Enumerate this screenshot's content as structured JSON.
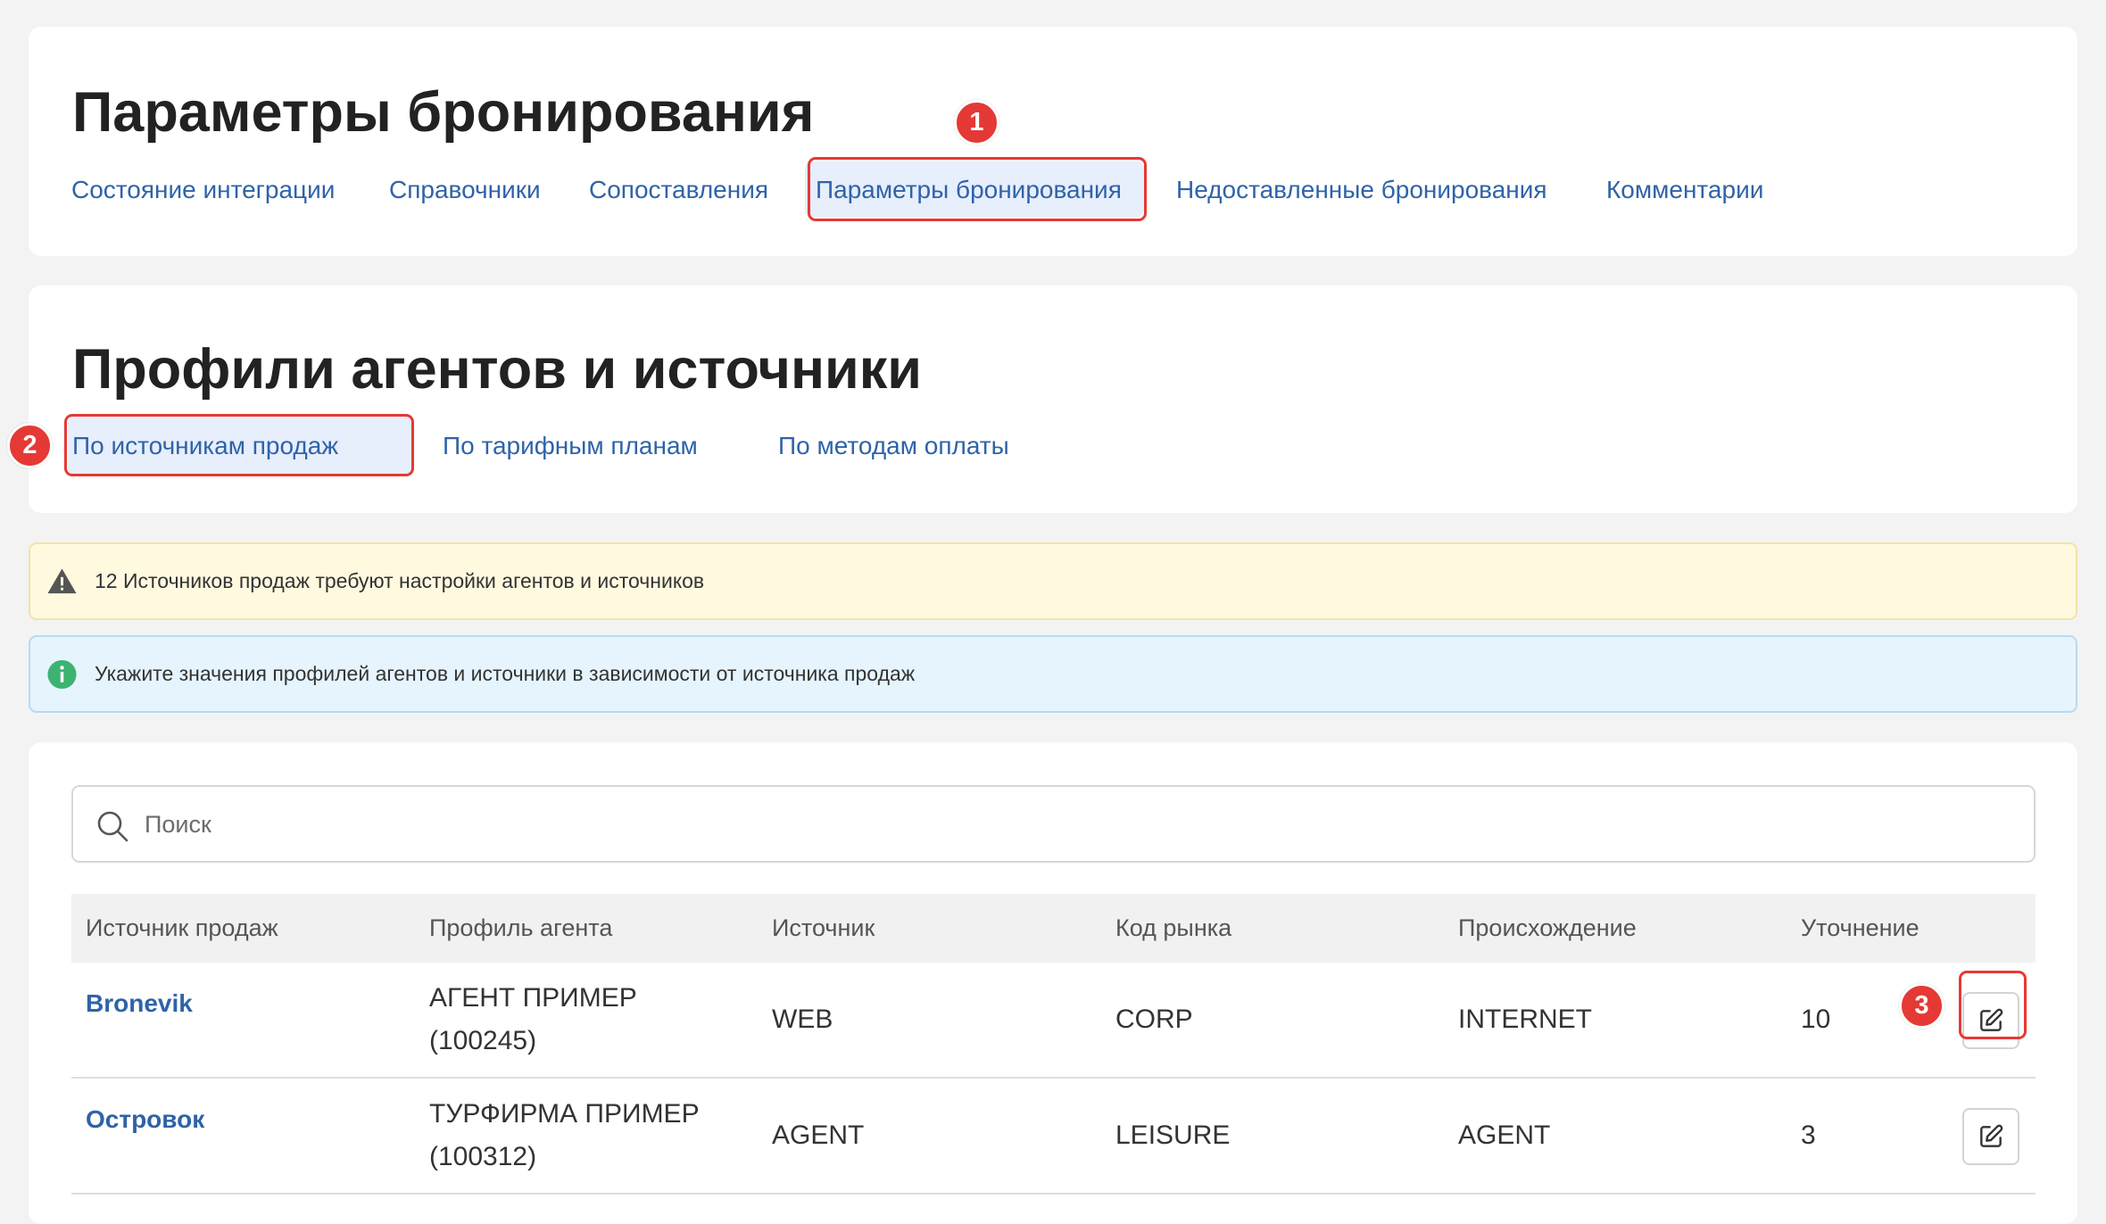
{
  "header": {
    "title": "Параметры бронирования",
    "tabs": [
      {
        "label": "Состояние интеграции"
      },
      {
        "label": "Справочники"
      },
      {
        "label": "Сопоставления"
      },
      {
        "label": "Параметры бронирования",
        "active": true
      },
      {
        "label": "Недоставленные бронирования"
      },
      {
        "label": "Комментарии"
      }
    ]
  },
  "section": {
    "title": "Профили агентов и источники",
    "tabs": [
      {
        "label": "По источникам продаж",
        "active": true
      },
      {
        "label": "По тарифным планам"
      },
      {
        "label": "По методам оплаты"
      }
    ]
  },
  "alerts": {
    "warning": {
      "text": "12 Источников продаж требуют настройки агентов и источников",
      "icon": "warning-icon"
    },
    "info": {
      "text": "Укажите значения профилей агентов и источники в зависимости от источника продаж",
      "icon": "info-icon"
    }
  },
  "search": {
    "placeholder": "Поиск",
    "value": ""
  },
  "table": {
    "columns": [
      "Источник продаж",
      "Профиль агента",
      "Источник",
      "Код рынка",
      "Происхождение",
      "Уточнение"
    ],
    "rows": [
      {
        "source": "Bronevik",
        "agent_name": "АГЕНТ ПРИМЕР",
        "agent_id": "(100245)",
        "channel": "WEB",
        "market_code": "CORP",
        "origin": "INTERNET",
        "refinement": "10"
      },
      {
        "source": "Островок",
        "agent_name": "ТУРФИРМА ПРИМЕР",
        "agent_id": "(100312)",
        "channel": "AGENT",
        "market_code": "LEISURE",
        "origin": "AGENT",
        "refinement": "3"
      }
    ]
  },
  "markers": [
    "1",
    "2",
    "3"
  ],
  "colors": {
    "link": "#2f63a8",
    "marker": "#e53935",
    "warning_bg": "#fff9e0",
    "info_bg": "#e6f4fd",
    "page_bg": "#f3f3f3"
  }
}
